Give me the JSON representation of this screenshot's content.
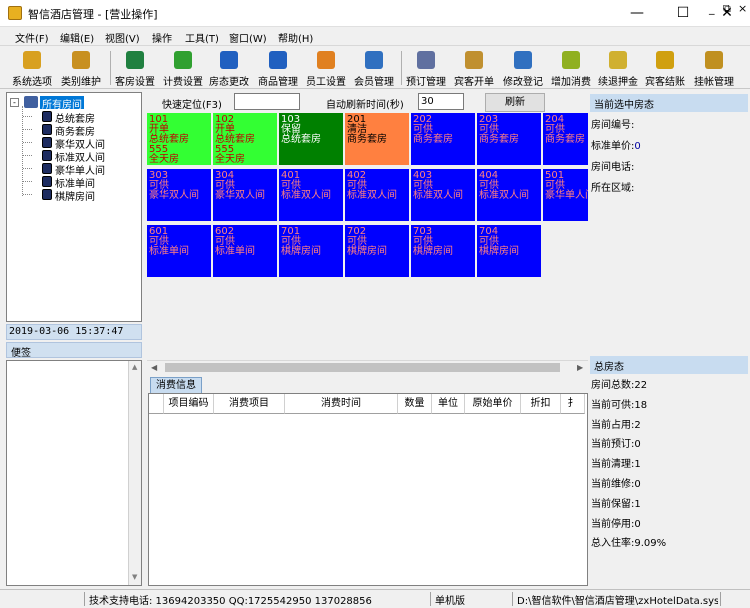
{
  "window": {
    "title": "智信酒店管理 - [营业操作]"
  },
  "menu": [
    {
      "label": "文件(F)"
    },
    {
      "label": "编辑(E)"
    },
    {
      "label": "视图(V)"
    },
    {
      "label": "操作"
    },
    {
      "label": "工具(T)"
    },
    {
      "label": "窗口(W)"
    },
    {
      "label": "帮助(H)"
    }
  ],
  "toolbar": [
    {
      "label": "系统选项",
      "icon": "key-icon",
      "color": "#d8a020"
    },
    {
      "label": "类别维护",
      "icon": "key-icon",
      "color": "#c89020"
    },
    {
      "label": "客房设置",
      "icon": "bed-icon",
      "color": "#208040"
    },
    {
      "label": "计费设置",
      "icon": "billing-icon",
      "color": "#30a030"
    },
    {
      "label": "房态更改",
      "icon": "room-state-icon",
      "color": "#2060c0"
    },
    {
      "label": "商品管理",
      "icon": "goods-icon",
      "color": "#2060c0"
    },
    {
      "label": "员工设置",
      "icon": "staff-icon",
      "color": "#e08020"
    },
    {
      "label": "会员管理",
      "icon": "member-icon",
      "color": "#3070c0"
    },
    {
      "label": "预订管理",
      "icon": "booking-icon",
      "color": "#6070a0"
    },
    {
      "label": "宾客开单",
      "icon": "checkin-icon",
      "color": "#c09030"
    },
    {
      "label": "修改登记",
      "icon": "edit-register-icon",
      "color": "#3070c0"
    },
    {
      "label": "增加消费",
      "icon": "add-consume-icon",
      "color": "#90b020"
    },
    {
      "label": "续退押金",
      "icon": "deposit-icon",
      "color": "#d0b030"
    },
    {
      "label": "宾客结账",
      "icon": "checkout-icon",
      "color": "#d0a010"
    },
    {
      "label": "挂帐管理",
      "icon": "credit-icon",
      "color": "#c09020"
    }
  ],
  "tree": {
    "root": "所有房间",
    "items": [
      "总统套房",
      "商务套房",
      "豪华双人间",
      "标准双人间",
      "豪华单人间",
      "标准单间",
      "棋牌房间"
    ]
  },
  "datetime": "2019-03-06 15:37:47",
  "note_label": "便签",
  "controls": {
    "quick_label": "快速定位(F3)",
    "quick_value": "",
    "refresh_label": "自动刷新时间(秒)",
    "refresh_value": "30",
    "refresh_button": "刷新"
  },
  "rooms": [
    {
      "no": "101",
      "status": "开单",
      "type": "总统套房",
      "extra1": "555",
      "extra2": "全天房",
      "bg": "#33ff33",
      "fg": "#c00000"
    },
    {
      "no": "102",
      "status": "开单",
      "type": "总统套房",
      "extra1": "555",
      "extra2": "全天房",
      "bg": "#33ff33",
      "fg": "#c00000"
    },
    {
      "no": "103",
      "status": "保留",
      "type": "总统套房",
      "extra1": "",
      "extra2": "",
      "bg": "#008000",
      "fg": "#ffffff"
    },
    {
      "no": "201",
      "status": "清洁",
      "type": "商务套房",
      "extra1": "",
      "extra2": "",
      "bg": "#ff8040",
      "fg": "#000000"
    },
    {
      "no": "202",
      "status": "可供",
      "type": "商务套房",
      "extra1": "",
      "extra2": "",
      "bg": "#0000ff",
      "fg": "#ff8080"
    },
    {
      "no": "203",
      "status": "可供",
      "type": "商务套房",
      "extra1": "",
      "extra2": "",
      "bg": "#0000ff",
      "fg": "#ff8080"
    },
    {
      "no": "204",
      "status": "可供",
      "type": "商务套房",
      "extra1": "",
      "extra2": "",
      "bg": "#0000ff",
      "fg": "#ff8080"
    },
    {
      "no": "303",
      "status": "可供",
      "type": "豪华双人间",
      "extra1": "",
      "extra2": "",
      "bg": "#0000ff",
      "fg": "#ff8080"
    },
    {
      "no": "304",
      "status": "可供",
      "type": "豪华双人间",
      "extra1": "",
      "extra2": "",
      "bg": "#0000ff",
      "fg": "#ff8080"
    },
    {
      "no": "401",
      "status": "可供",
      "type": "标准双人间",
      "extra1": "",
      "extra2": "",
      "bg": "#0000ff",
      "fg": "#ff8080"
    },
    {
      "no": "402",
      "status": "可供",
      "type": "标准双人间",
      "extra1": "",
      "extra2": "",
      "bg": "#0000ff",
      "fg": "#ff8080"
    },
    {
      "no": "403",
      "status": "可供",
      "type": "标准双人间",
      "extra1": "",
      "extra2": "",
      "bg": "#0000ff",
      "fg": "#ff8080"
    },
    {
      "no": "404",
      "status": "可供",
      "type": "标准双人间",
      "extra1": "",
      "extra2": "",
      "bg": "#0000ff",
      "fg": "#ff8080"
    },
    {
      "no": "501",
      "status": "可供",
      "type": "豪华单人间",
      "extra1": "",
      "extra2": "",
      "bg": "#0000ff",
      "fg": "#ff8080"
    },
    {
      "no": "601",
      "status": "可供",
      "type": "标准单间",
      "extra1": "",
      "extra2": "",
      "bg": "#0000ff",
      "fg": "#ff8080"
    },
    {
      "no": "602",
      "status": "可供",
      "type": "标准单间",
      "extra1": "",
      "extra2": "",
      "bg": "#0000ff",
      "fg": "#ff8080"
    },
    {
      "no": "701",
      "status": "可供",
      "type": "棋牌房间",
      "extra1": "",
      "extra2": "",
      "bg": "#0000ff",
      "fg": "#ff8080"
    },
    {
      "no": "702",
      "status": "可供",
      "type": "棋牌房间",
      "extra1": "",
      "extra2": "",
      "bg": "#0000ff",
      "fg": "#ff8080"
    },
    {
      "no": "703",
      "status": "可供",
      "type": "棋牌房间",
      "extra1": "",
      "extra2": "",
      "bg": "#0000ff",
      "fg": "#ff8080"
    },
    {
      "no": "704",
      "status": "可供",
      "type": "棋牌房间",
      "extra1": "",
      "extra2": "",
      "bg": "#0000ff",
      "fg": "#ff8080"
    }
  ],
  "consume": {
    "tab": "消费信息",
    "columns": [
      "项目编码",
      "消费项目",
      "消费时间",
      "数量",
      "单位",
      "原始单价",
      "折扣",
      "扌"
    ]
  },
  "selected": {
    "header": "当前选中房态",
    "rows": [
      {
        "label": "房间编号:",
        "value": ""
      },
      {
        "label": "标准单价:",
        "value": "0"
      },
      {
        "label": "房间电话:",
        "value": ""
      },
      {
        "label": "所在区域:",
        "value": ""
      }
    ]
  },
  "summary": {
    "header": "总房态",
    "rows": [
      {
        "label": "房间总数:",
        "value": "22"
      },
      {
        "label": "当前可供:",
        "value": "18"
      },
      {
        "label": "当前占用:",
        "value": "2"
      },
      {
        "label": "当前预订:",
        "value": "0"
      },
      {
        "label": "当前清理:",
        "value": "1"
      },
      {
        "label": "当前维修:",
        "value": "0"
      },
      {
        "label": "当前保留:",
        "value": "1"
      },
      {
        "label": "当前停用:",
        "value": "0"
      },
      {
        "label": "总入住率:",
        "value": "9.09%"
      }
    ]
  },
  "status": {
    "support": "技术支持电话: 13694203350 QQ:1725542950 137028856",
    "edition": "单机版",
    "path": "D:\\智信软件\\智信酒店管理\\zxHotelData.sys"
  }
}
